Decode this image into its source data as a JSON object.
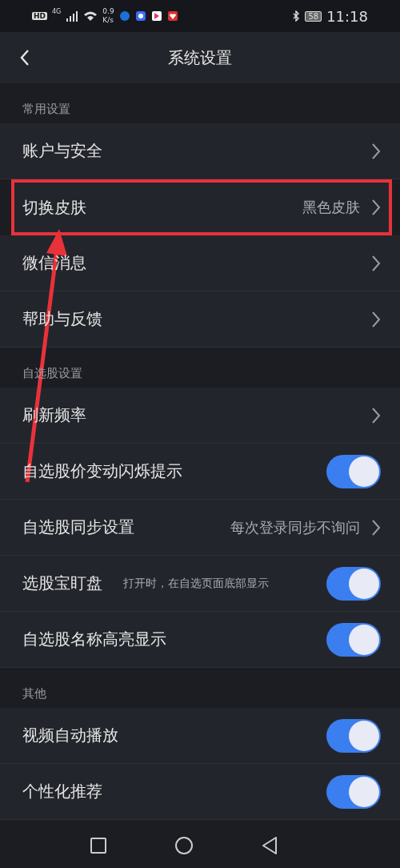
{
  "status_bar": {
    "hd": "HD",
    "network": "4G",
    "speed_value": "0.9",
    "speed_unit": "K/s",
    "battery": "58",
    "time": "11:18"
  },
  "header": {
    "title": "系统设置"
  },
  "sections": [
    {
      "title": "常用设置",
      "items": [
        {
          "kind": "link",
          "label": "账户与安全",
          "highlighted": false
        },
        {
          "kind": "link",
          "label": "切换皮肤",
          "value": "黑色皮肤",
          "highlighted": true
        },
        {
          "kind": "link",
          "label": "微信消息",
          "highlighted": false
        },
        {
          "kind": "link",
          "label": "帮助与反馈",
          "highlighted": false
        }
      ]
    },
    {
      "title": "自选股设置",
      "items": [
        {
          "kind": "link",
          "label": "刷新频率",
          "highlighted": false
        },
        {
          "kind": "toggle",
          "label": "自选股价变动闪烁提示",
          "on": true,
          "highlighted": false
        },
        {
          "kind": "link",
          "label": "自选股同步设置",
          "value": "每次登录同步不询问",
          "highlighted": false
        },
        {
          "kind": "toggle",
          "label": "选股宝盯盘",
          "note": "打开时，在自选页面底部显示",
          "on": true,
          "highlighted": false
        },
        {
          "kind": "toggle",
          "label": "自选股名称高亮显示",
          "on": true,
          "highlighted": false
        }
      ]
    },
    {
      "title": "其他",
      "items": [
        {
          "kind": "toggle",
          "label": "视频自动播放",
          "on": true,
          "highlighted": false
        },
        {
          "kind": "toggle",
          "label": "个性化推荐",
          "on": true,
          "highlighted": false
        }
      ]
    }
  ]
}
